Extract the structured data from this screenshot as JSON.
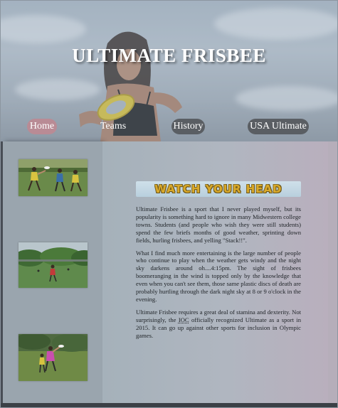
{
  "hero": {
    "title": "ULTIMATE FRISBEE"
  },
  "nav": {
    "items": [
      {
        "label": "Home",
        "active": true
      },
      {
        "label": "Teams",
        "active": false
      },
      {
        "label": "History",
        "active": false
      },
      {
        "label": "USA Ultimate",
        "active": false
      }
    ]
  },
  "banner": {
    "text": "WATCH YOUR HEAD"
  },
  "article": {
    "paragraphs": [
      "Ultimate Frisbee is a sport that I never played myself, but its popularity is something hard to ignore in many Midwestern college towns. Students (and people who wish they were still students) spend the few briefs months of good weather, sprinting down fields, hurling frisbees, and yelling \"Stack!!\".",
      "What I find much more entertaining is the large number of people who continue to play when the weather gets windy and the night sky darkens around oh....4:15pm. The sight of frisbees boomeranging in the wind is topped only by the knowledge that even when you can't see them, those same plastic discs of death are probably hurtling through the dark night sky at 8 or 9 o'clock in the evening."
    ],
    "p3_before": "Ultimate Frisbee requires a great deal of stamina and dexterity. Not surprisingly, the ",
    "p3_abbr": "IOC",
    "p3_after": " officially recognized Ultimate as a sport in 2015. It can go up against other sports for inclusion in Olympic games."
  },
  "sidebar": {
    "images": [
      "frisbee-players-photo",
      "field-game-photo",
      "catch-action-photo"
    ]
  },
  "colors": {
    "nav_active": "#b98b95",
    "nav_default": "#5a5e63",
    "banner_text": "#d9a92a"
  }
}
